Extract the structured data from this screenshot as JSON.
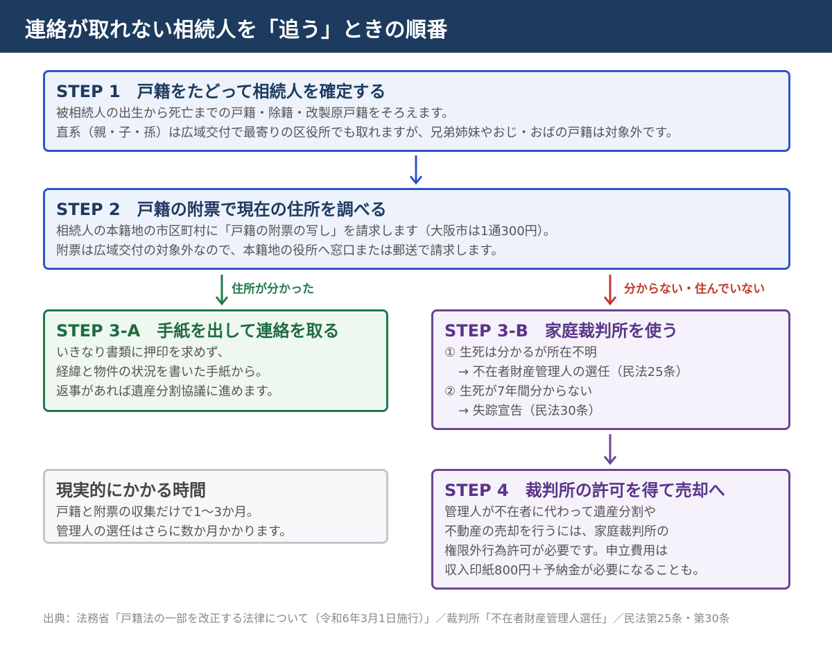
{
  "header": {
    "title": "連絡が取れない相続人を「追う」ときの順番"
  },
  "step1": {
    "title": "STEP 1　戸籍をたどって相続人を確定する",
    "lines": [
      "被相続人の出生から死亡までの戸籍・除籍・改製原戸籍をそろえます。",
      "直系（親・子・孫）は広域交付で最寄りの区役所でも取れますが、兄弟姉妹やおじ・おばの戸籍は対象外です。"
    ]
  },
  "step2": {
    "title": "STEP 2　戸籍の附票で現在の住所を調べる",
    "lines": [
      "相続人の本籍地の市区町村に「戸籍の附票の写し」を請求します（大阪市は1通300円）。",
      "附票は広域交付の対象外なので、本籍地の役所へ窓口または郵送で請求します。"
    ]
  },
  "branch": {
    "found_label": "住所が分かった",
    "not_found_label": "分からない・住んでいない"
  },
  "step3a": {
    "title": "STEP 3-A　手紙を出して連絡を取る",
    "lines": [
      "いきなり書類に押印を求めず、",
      "経緯と物件の状況を書いた手紙から。",
      "返事があれば遺産分割協議に進めます。"
    ]
  },
  "step3b": {
    "title": "STEP 3-B　家庭裁判所を使う",
    "lines": [
      "① 生死は分かるが所在不明",
      "→ 不在者財産管理人の選任（民法25条）",
      "② 生死が7年間分からない",
      "→ 失踪宣告（民法30条）"
    ]
  },
  "time": {
    "title": "現実的にかかる時間",
    "lines": [
      "戸籍と附票の収集だけで1〜3か月。",
      "管理人の選任はさらに数か月かかります。"
    ]
  },
  "step4": {
    "title": "STEP 4　裁判所の許可を得て売却へ",
    "lines": [
      "管理人が不在者に代わって遺産分割や",
      "不動産の売却を行うには、家庭裁判所の",
      "権限外行為許可が必要です。申立費用は",
      "収入印紙800円＋予納金が必要になることも。"
    ]
  },
  "source": "出典：法務省「戸籍法の一部を改正する法律について（令和6年3月1日施行）」／裁判所「不在者財産管理人選任」／民法第25条・第30条",
  "colors": {
    "header_bg": "#1d3a5f",
    "blue_border": "#2e56c6",
    "green_border": "#1f7a4a",
    "red_label": "#c0392b",
    "purple_border": "#6a4594",
    "gray_border": "#c3c6cc"
  }
}
